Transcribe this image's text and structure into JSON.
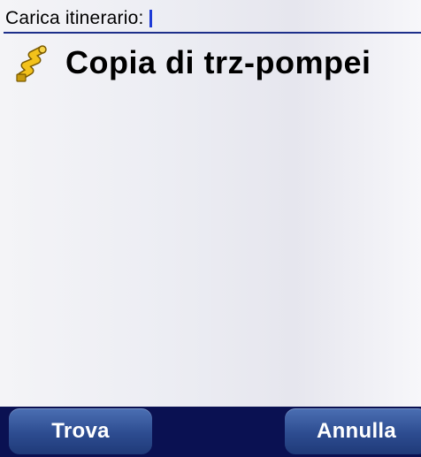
{
  "search": {
    "label": "Carica itinerario:"
  },
  "results": [
    {
      "label": "Copia di trz-pompei",
      "icon": "route-itinerary-icon"
    }
  ],
  "buttons": {
    "find": "Trova",
    "cancel": "Annulla"
  },
  "colors": {
    "accent": "#1d2f8a",
    "caret": "#1d3bd6",
    "bottom_bar": "#0a1152",
    "button": "#2d4c90"
  }
}
